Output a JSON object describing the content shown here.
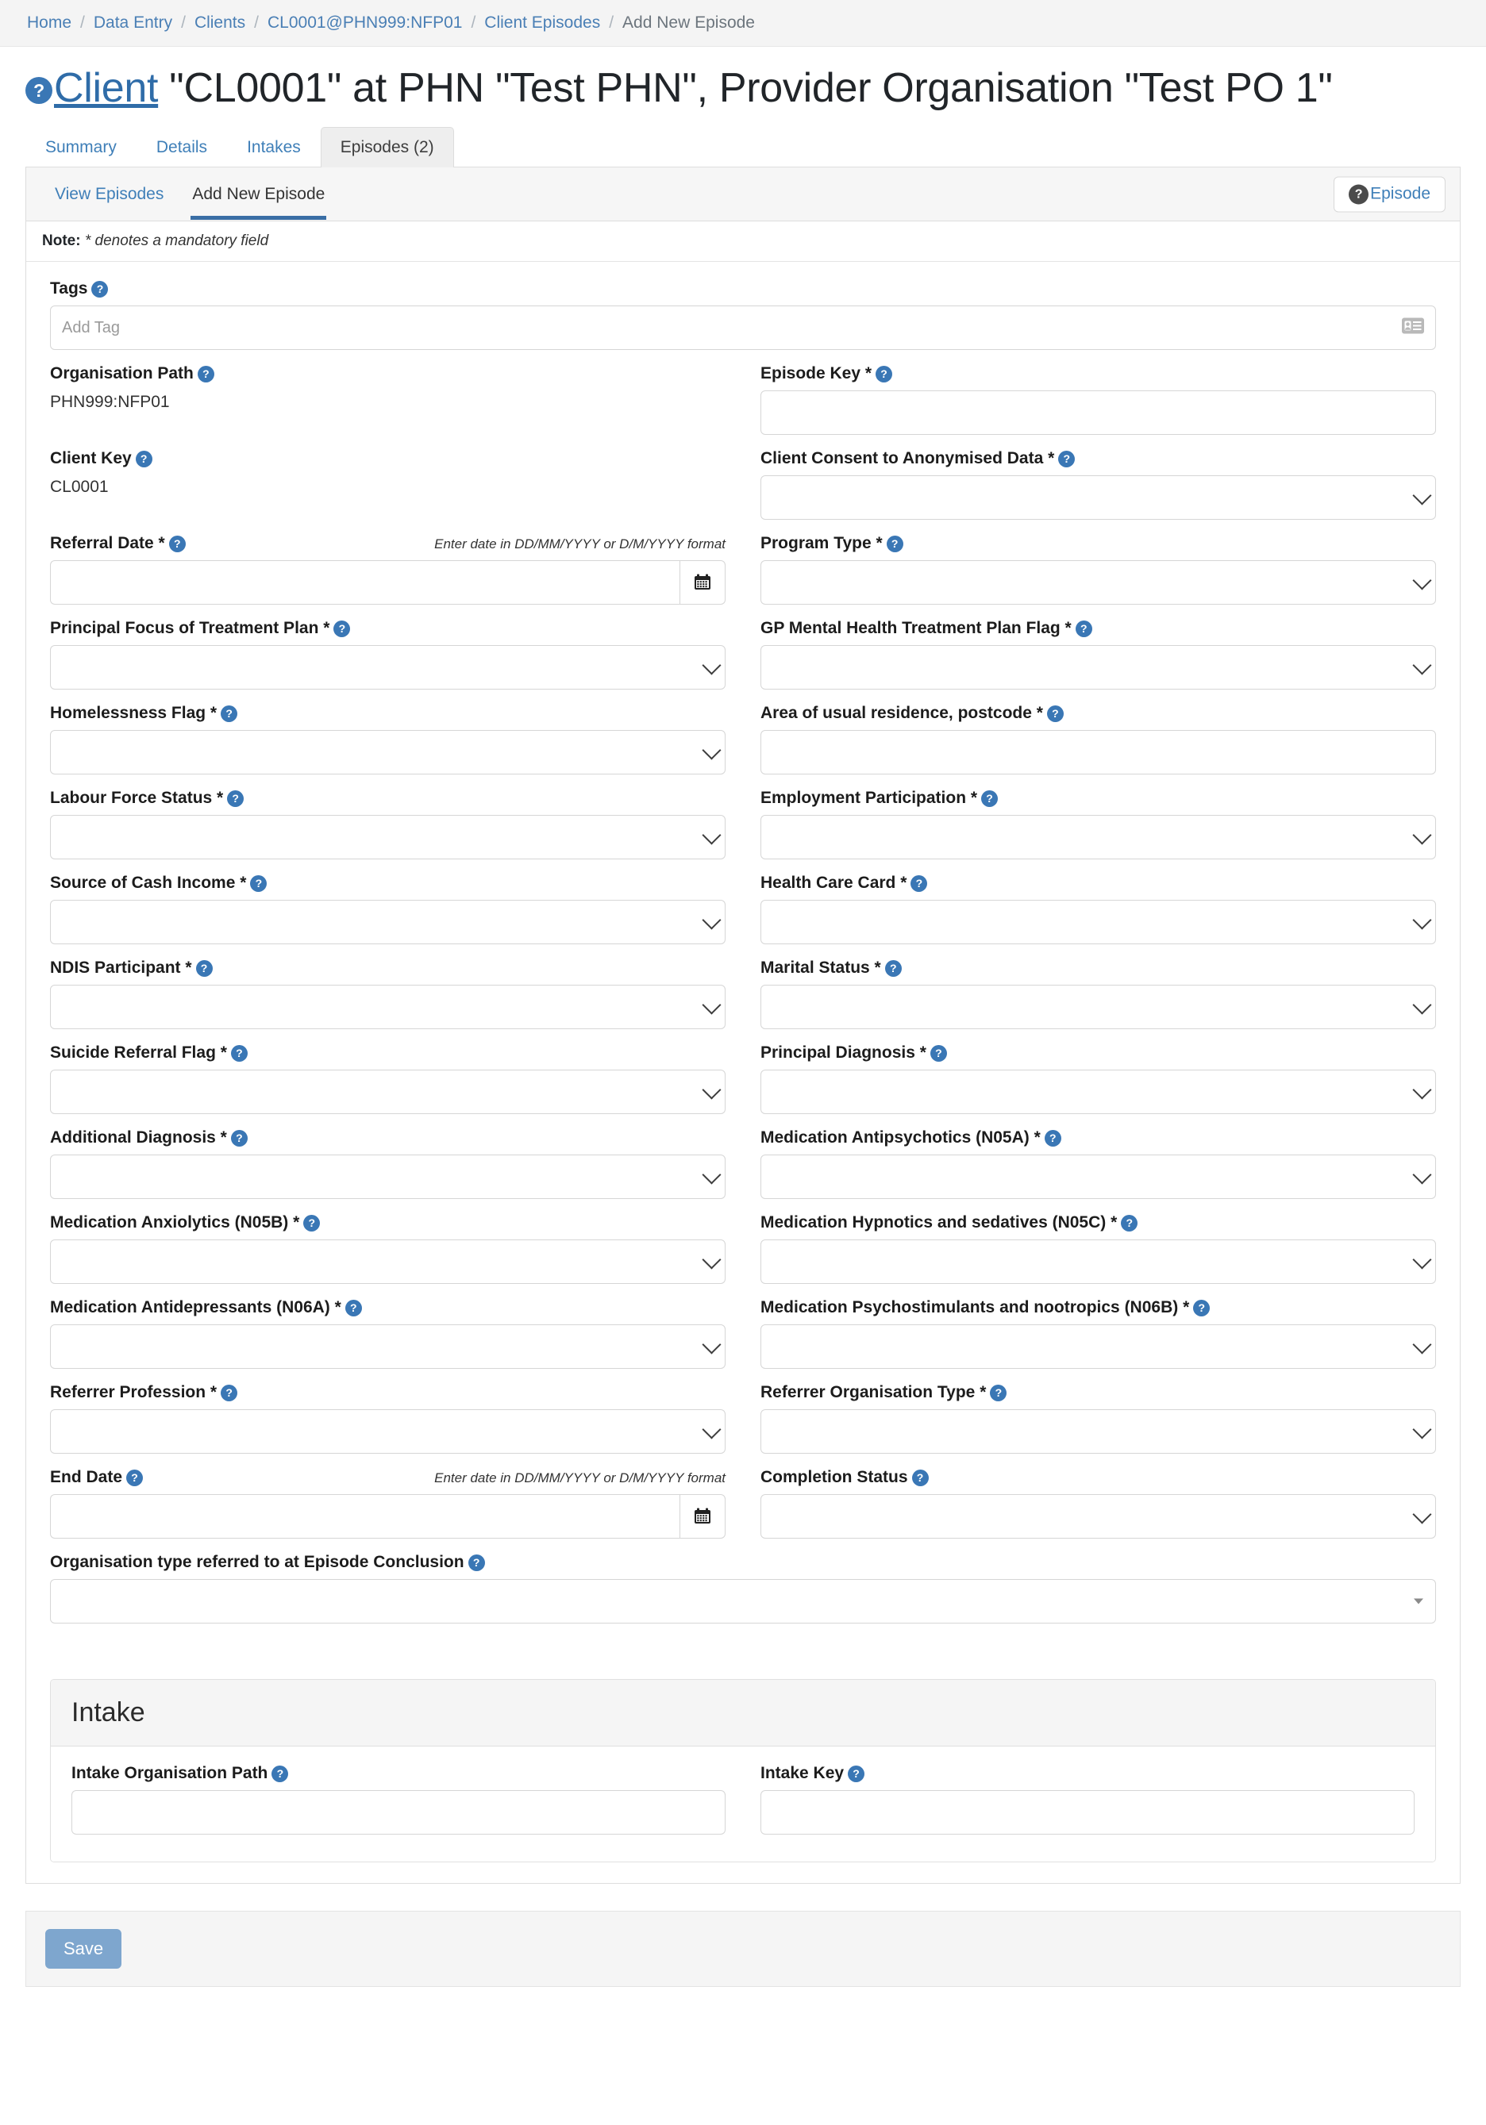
{
  "breadcrumb": {
    "items": [
      {
        "label": "Home",
        "link": true
      },
      {
        "label": "Data Entry",
        "link": true
      },
      {
        "label": "Clients",
        "link": true
      },
      {
        "label": "CL0001@PHN999:NFP01",
        "link": true
      },
      {
        "label": "Client Episodes",
        "link": true
      },
      {
        "label": "Add New Episode",
        "link": false
      }
    ],
    "separator": "/"
  },
  "header": {
    "help_glyph": "?",
    "link_text": "Client",
    "title_rest": " \"CL0001\" at PHN \"Test PHN\", Provider Organisation \"Test PO 1\""
  },
  "tabs": [
    {
      "label": "Summary",
      "active": false
    },
    {
      "label": "Details",
      "active": false
    },
    {
      "label": "Intakes",
      "active": false
    },
    {
      "label": "Episodes (2)",
      "active": true
    }
  ],
  "subtabs": [
    {
      "label": "View Episodes",
      "active": false
    },
    {
      "label": "Add New Episode",
      "active": true
    }
  ],
  "episode_button": {
    "label": "Episode",
    "help_glyph": "?"
  },
  "note": {
    "prefix": "Note:",
    "text": "* denotes a mandatory field"
  },
  "tags": {
    "label": "Tags",
    "placeholder": "Add Tag",
    "icon": "contact-card-icon"
  },
  "date_hint": "Enter date in DD/MM/YYYY or D/M/YYYY format",
  "fields": {
    "organisation_path": {
      "label": "Organisation Path",
      "value": "PHN999:NFP01"
    },
    "episode_key": {
      "label": "Episode Key *",
      "value": ""
    },
    "client_key": {
      "label": "Client Key",
      "value": "CL0001"
    },
    "client_consent": {
      "label": "Client Consent to Anonymised Data *",
      "value": ""
    },
    "referral_date": {
      "label": "Referral Date *",
      "value": ""
    },
    "program_type": {
      "label": "Program Type *",
      "value": ""
    },
    "principal_focus": {
      "label": "Principal Focus of Treatment Plan *",
      "value": ""
    },
    "gp_mh_plan_flag": {
      "label": "GP Mental Health Treatment Plan Flag *",
      "value": ""
    },
    "homelessness_flag": {
      "label": "Homelessness Flag *",
      "value": ""
    },
    "postcode": {
      "label": "Area of usual residence, postcode *",
      "value": ""
    },
    "labour_force_status": {
      "label": "Labour Force Status *",
      "value": ""
    },
    "employment_participation": {
      "label": "Employment Participation *",
      "value": ""
    },
    "source_cash_income": {
      "label": "Source of Cash Income *",
      "value": ""
    },
    "health_care_card": {
      "label": "Health Care Card *",
      "value": ""
    },
    "ndis_participant": {
      "label": "NDIS Participant *",
      "value": ""
    },
    "marital_status": {
      "label": "Marital Status *",
      "value": ""
    },
    "suicide_referral_flag": {
      "label": "Suicide Referral Flag *",
      "value": ""
    },
    "principal_diagnosis": {
      "label": "Principal Diagnosis *",
      "value": ""
    },
    "additional_diagnosis": {
      "label": "Additional Diagnosis *",
      "value": ""
    },
    "med_antipsychotics": {
      "label": "Medication Antipsychotics (N05A) *",
      "value": ""
    },
    "med_anxiolytics": {
      "label": "Medication Anxiolytics (N05B) *",
      "value": ""
    },
    "med_hypnotics": {
      "label": "Medication Hypnotics and sedatives (N05C) *",
      "value": ""
    },
    "med_antidepressants": {
      "label": "Medication Antidepressants (N06A) *",
      "value": ""
    },
    "med_psychostimulants": {
      "label": "Medication Psychostimulants and nootropics (N06B) *",
      "value": ""
    },
    "referrer_profession": {
      "label": "Referrer Profession *",
      "value": ""
    },
    "referrer_org_type": {
      "label": "Referrer Organisation Type *",
      "value": ""
    },
    "end_date": {
      "label": "End Date",
      "value": ""
    },
    "completion_status": {
      "label": "Completion Status",
      "value": ""
    },
    "org_type_conclusion": {
      "label": "Organisation type referred to at Episode Conclusion",
      "value": ""
    }
  },
  "intake": {
    "title": "Intake",
    "organisation_path": {
      "label": "Intake Organisation Path",
      "value": ""
    },
    "key": {
      "label": "Intake Key",
      "value": ""
    }
  },
  "footer": {
    "save_label": "Save"
  },
  "colors": {
    "link": "#3f7fb8",
    "help_badge": "#3a77b5",
    "active_underline": "#3a6ea5",
    "save_button": "#7ea6ce",
    "breadcrumb_bg": "#f4f4f4"
  }
}
